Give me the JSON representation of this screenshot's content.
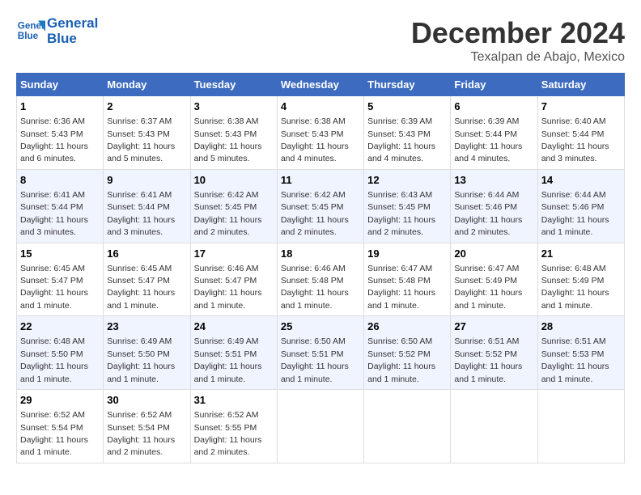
{
  "header": {
    "logo_line1": "General",
    "logo_line2": "Blue",
    "month": "December 2024",
    "location": "Texalpan de Abajo, Mexico"
  },
  "days_of_week": [
    "Sunday",
    "Monday",
    "Tuesday",
    "Wednesday",
    "Thursday",
    "Friday",
    "Saturday"
  ],
  "weeks": [
    [
      {
        "day": "1",
        "sunrise": "6:36 AM",
        "sunset": "5:43 PM",
        "daylight": "11 hours and 6 minutes."
      },
      {
        "day": "2",
        "sunrise": "6:37 AM",
        "sunset": "5:43 PM",
        "daylight": "11 hours and 5 minutes."
      },
      {
        "day": "3",
        "sunrise": "6:38 AM",
        "sunset": "5:43 PM",
        "daylight": "11 hours and 5 minutes."
      },
      {
        "day": "4",
        "sunrise": "6:38 AM",
        "sunset": "5:43 PM",
        "daylight": "11 hours and 4 minutes."
      },
      {
        "day": "5",
        "sunrise": "6:39 AM",
        "sunset": "5:43 PM",
        "daylight": "11 hours and 4 minutes."
      },
      {
        "day": "6",
        "sunrise": "6:39 AM",
        "sunset": "5:44 PM",
        "daylight": "11 hours and 4 minutes."
      },
      {
        "day": "7",
        "sunrise": "6:40 AM",
        "sunset": "5:44 PM",
        "daylight": "11 hours and 3 minutes."
      }
    ],
    [
      {
        "day": "8",
        "sunrise": "6:41 AM",
        "sunset": "5:44 PM",
        "daylight": "11 hours and 3 minutes."
      },
      {
        "day": "9",
        "sunrise": "6:41 AM",
        "sunset": "5:44 PM",
        "daylight": "11 hours and 3 minutes."
      },
      {
        "day": "10",
        "sunrise": "6:42 AM",
        "sunset": "5:45 PM",
        "daylight": "11 hours and 2 minutes."
      },
      {
        "day": "11",
        "sunrise": "6:42 AM",
        "sunset": "5:45 PM",
        "daylight": "11 hours and 2 minutes."
      },
      {
        "day": "12",
        "sunrise": "6:43 AM",
        "sunset": "5:45 PM",
        "daylight": "11 hours and 2 minutes."
      },
      {
        "day": "13",
        "sunrise": "6:44 AM",
        "sunset": "5:46 PM",
        "daylight": "11 hours and 2 minutes."
      },
      {
        "day": "14",
        "sunrise": "6:44 AM",
        "sunset": "5:46 PM",
        "daylight": "11 hours and 1 minute."
      }
    ],
    [
      {
        "day": "15",
        "sunrise": "6:45 AM",
        "sunset": "5:47 PM",
        "daylight": "11 hours and 1 minute."
      },
      {
        "day": "16",
        "sunrise": "6:45 AM",
        "sunset": "5:47 PM",
        "daylight": "11 hours and 1 minute."
      },
      {
        "day": "17",
        "sunrise": "6:46 AM",
        "sunset": "5:47 PM",
        "daylight": "11 hours and 1 minute."
      },
      {
        "day": "18",
        "sunrise": "6:46 AM",
        "sunset": "5:48 PM",
        "daylight": "11 hours and 1 minute."
      },
      {
        "day": "19",
        "sunrise": "6:47 AM",
        "sunset": "5:48 PM",
        "daylight": "11 hours and 1 minute."
      },
      {
        "day": "20",
        "sunrise": "6:47 AM",
        "sunset": "5:49 PM",
        "daylight": "11 hours and 1 minute."
      },
      {
        "day": "21",
        "sunrise": "6:48 AM",
        "sunset": "5:49 PM",
        "daylight": "11 hours and 1 minute."
      }
    ],
    [
      {
        "day": "22",
        "sunrise": "6:48 AM",
        "sunset": "5:50 PM",
        "daylight": "11 hours and 1 minute."
      },
      {
        "day": "23",
        "sunrise": "6:49 AM",
        "sunset": "5:50 PM",
        "daylight": "11 hours and 1 minute."
      },
      {
        "day": "24",
        "sunrise": "6:49 AM",
        "sunset": "5:51 PM",
        "daylight": "11 hours and 1 minute."
      },
      {
        "day": "25",
        "sunrise": "6:50 AM",
        "sunset": "5:51 PM",
        "daylight": "11 hours and 1 minute."
      },
      {
        "day": "26",
        "sunrise": "6:50 AM",
        "sunset": "5:52 PM",
        "daylight": "11 hours and 1 minute."
      },
      {
        "day": "27",
        "sunrise": "6:51 AM",
        "sunset": "5:52 PM",
        "daylight": "11 hours and 1 minute."
      },
      {
        "day": "28",
        "sunrise": "6:51 AM",
        "sunset": "5:53 PM",
        "daylight": "11 hours and 1 minute."
      }
    ],
    [
      {
        "day": "29",
        "sunrise": "6:52 AM",
        "sunset": "5:54 PM",
        "daylight": "11 hours and 1 minute."
      },
      {
        "day": "30",
        "sunrise": "6:52 AM",
        "sunset": "5:54 PM",
        "daylight": "11 hours and 2 minutes."
      },
      {
        "day": "31",
        "sunrise": "6:52 AM",
        "sunset": "5:55 PM",
        "daylight": "11 hours and 2 minutes."
      },
      {
        "day": "",
        "sunrise": "",
        "sunset": "",
        "daylight": ""
      },
      {
        "day": "",
        "sunrise": "",
        "sunset": "",
        "daylight": ""
      },
      {
        "day": "",
        "sunrise": "",
        "sunset": "",
        "daylight": ""
      },
      {
        "day": "",
        "sunrise": "",
        "sunset": "",
        "daylight": ""
      }
    ]
  ]
}
